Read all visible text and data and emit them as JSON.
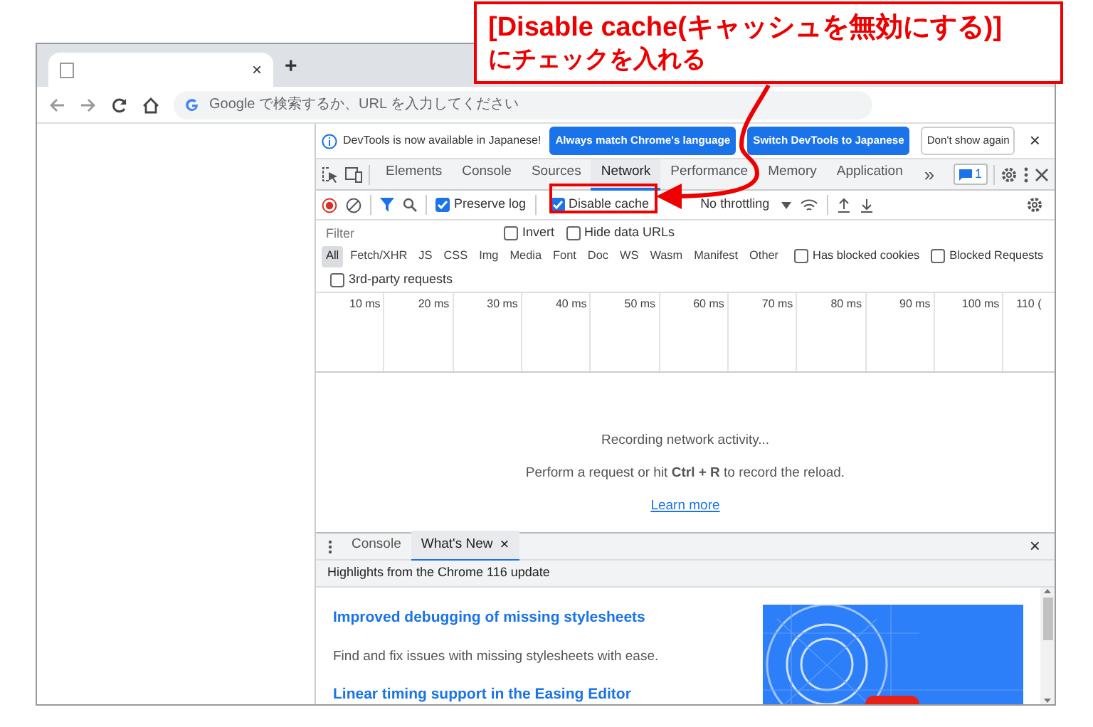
{
  "browser": {
    "tab_close": "×",
    "new_tab": "+",
    "omnibox": {
      "placeholder": "Google で検索するか、URL を入力してください"
    }
  },
  "devtools": {
    "infobar": {
      "message": "DevTools is now available in Japanese!",
      "buttons": [
        {
          "label": "Always match Chrome's language",
          "kind": "primary"
        },
        {
          "label": "Switch DevTools to Japanese",
          "kind": "primary"
        },
        {
          "label": "Don't show again",
          "kind": "plain"
        }
      ]
    },
    "tabs": [
      {
        "label": "Elements",
        "selected": false
      },
      {
        "label": "Console",
        "selected": false
      },
      {
        "label": "Sources",
        "selected": false
      },
      {
        "label": "Network",
        "selected": true
      },
      {
        "label": "Performance",
        "selected": false
      },
      {
        "label": "Memory",
        "selected": false
      },
      {
        "label": "Application",
        "selected": false
      }
    ],
    "more_tabs": "»",
    "issues_count": "1",
    "network_toolbar": {
      "preserve_log": {
        "label": "Preserve log",
        "checked": true
      },
      "disable_cache": {
        "label": "Disable cache",
        "checked": true
      },
      "throttling": "No throttling"
    },
    "filter": {
      "placeholder": "Filter",
      "options": [
        {
          "label": "Invert",
          "checked": false
        },
        {
          "label": "Hide data URLs",
          "checked": false
        }
      ]
    },
    "types": [
      {
        "label": "All",
        "selected": true
      },
      {
        "label": "Fetch/XHR",
        "selected": false
      },
      {
        "label": "JS",
        "selected": false
      },
      {
        "label": "CSS",
        "selected": false
      },
      {
        "label": "Img",
        "selected": false
      },
      {
        "label": "Media",
        "selected": false
      },
      {
        "label": "Font",
        "selected": false
      },
      {
        "label": "Doc",
        "selected": false
      },
      {
        "label": "WS",
        "selected": false
      },
      {
        "label": "Wasm",
        "selected": false
      },
      {
        "label": "Manifest",
        "selected": false
      },
      {
        "label": "Other",
        "selected": false
      }
    ],
    "type_options": [
      {
        "label": "Has blocked cookies",
        "checked": false
      },
      {
        "label": "Blocked Requests",
        "checked": false
      },
      {
        "label": "3rd-party requests",
        "checked": false
      }
    ],
    "timeline_ticks": [
      "10 ms",
      "20 ms",
      "30 ms",
      "40 ms",
      "50 ms",
      "60 ms",
      "70 ms",
      "80 ms",
      "90 ms",
      "100 ms",
      "110 ("
    ],
    "empty": {
      "title": "Recording network activity...",
      "hint": "Perform a request or hit **Ctrl + R** to record the reload.",
      "link": "Learn more"
    },
    "drawer": {
      "tabs": [
        {
          "label": "Console",
          "selected": false,
          "closable": false
        },
        {
          "label": "What's New",
          "selected": true,
          "closable": true
        }
      ],
      "close": "×",
      "tab_close": "×",
      "header": "Highlights from the Chrome 116 update",
      "items": [
        {
          "kind": "heading",
          "text": "Improved debugging of missing stylesheets"
        },
        {
          "kind": "text",
          "text": "Find and fix issues with missing stylesheets with ease."
        },
        {
          "kind": "heading",
          "text": "Linear timing support in the Easing Editor"
        }
      ]
    }
  },
  "callout": {
    "lines": [
      "[Disable cache(キャッシュを無効にする)]",
      "にチェックを入れる"
    ]
  }
}
